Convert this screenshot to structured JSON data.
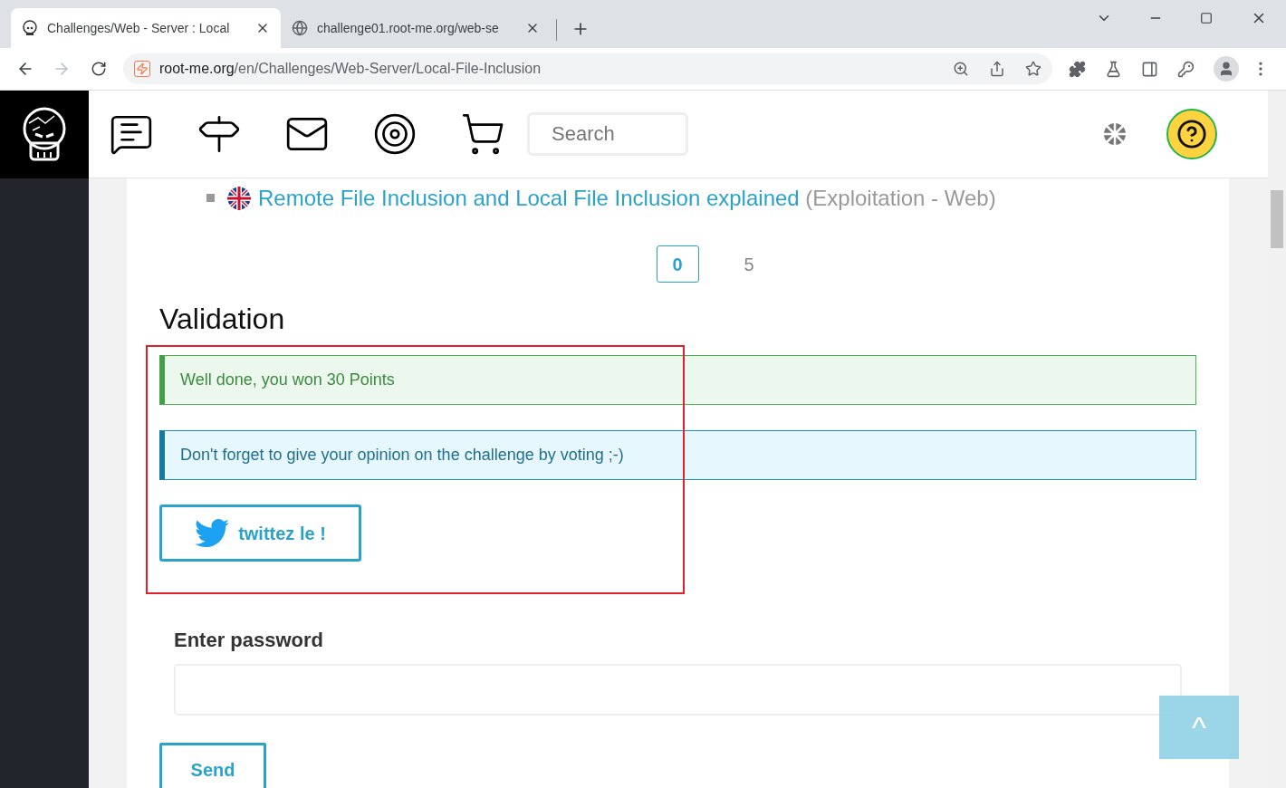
{
  "browser": {
    "tabs": [
      {
        "title": "Challenges/Web - Server : Local",
        "selected": true
      },
      {
        "title": "challenge01.root-me.org/web-se",
        "selected": false
      }
    ],
    "address": {
      "host": "root-me.org",
      "path": "/en/Challenges/Web-Server/Local-File-Inclusion"
    }
  },
  "site": {
    "search": {
      "placeholder": "Search"
    }
  },
  "resource": {
    "link": "Remote File Inclusion and Local File Inclusion explained",
    "category": "(Exploitation - Web)"
  },
  "pagination": [
    {
      "label": "0",
      "selected": true
    },
    {
      "label": "5",
      "selected": false
    }
  ],
  "validation": {
    "heading": "Validation",
    "success": "Well done, you won 30 Points",
    "info": "Don't forget to give your opinion on the challenge by voting ;-)",
    "tweet_button": "twittez le !"
  },
  "password": {
    "label": "Enter password",
    "send": "Send"
  },
  "back_to_top": "^"
}
